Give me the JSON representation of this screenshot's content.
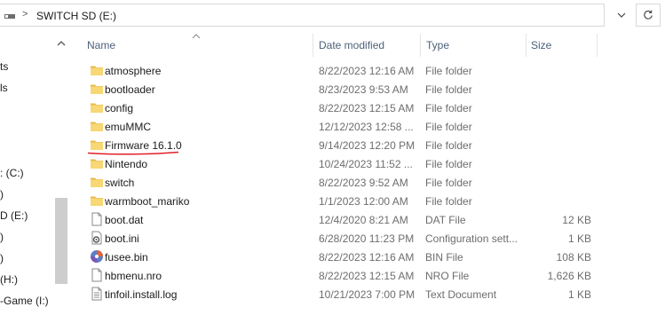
{
  "address_bar": {
    "separator": ">",
    "path": "SWITCH SD (E:)",
    "dropdown_icon": "chevron-down-icon",
    "refresh_icon": "refresh-icon"
  },
  "nav_pane": {
    "items": [
      {
        "label": "ts"
      },
      {
        "label": "ls"
      },
      {
        "label": ": (C:)"
      },
      {
        "label": ")"
      },
      {
        "label": "D (E:)"
      },
      {
        "label": ")"
      },
      {
        "label": ")"
      },
      {
        "label": "(H:)"
      },
      {
        "label": "-Game (I:)"
      }
    ]
  },
  "columns": {
    "name": "Name",
    "date_modified": "Date modified",
    "type": "Type",
    "size": "Size"
  },
  "files": [
    {
      "name": "atmosphere",
      "date": "8/22/2023 12:16 AM",
      "type": "File folder",
      "size": "",
      "icon": "folder-icon"
    },
    {
      "name": "bootloader",
      "date": "8/23/2023 9:53 AM",
      "type": "File folder",
      "size": "",
      "icon": "folder-icon"
    },
    {
      "name": "config",
      "date": "8/22/2023 12:15 AM",
      "type": "File folder",
      "size": "",
      "icon": "folder-icon"
    },
    {
      "name": "emuMMC",
      "date": "12/12/2023 12:58 ...",
      "type": "File folder",
      "size": "",
      "icon": "folder-icon"
    },
    {
      "name": "Firmware 16.1.0",
      "date": "9/14/2023 12:20 PM",
      "type": "File folder",
      "size": "",
      "icon": "folder-icon"
    },
    {
      "name": "Nintendo",
      "date": "10/24/2023 11:52 ...",
      "type": "File folder",
      "size": "",
      "icon": "folder-icon"
    },
    {
      "name": "switch",
      "date": "8/22/2023 9:52 AM",
      "type": "File folder",
      "size": "",
      "icon": "folder-icon"
    },
    {
      "name": "warmboot_mariko",
      "date": "1/1/2023 12:00 AM",
      "type": "File folder",
      "size": "",
      "icon": "folder-icon"
    },
    {
      "name": "boot.dat",
      "date": "12/4/2020 8:21 AM",
      "type": "DAT File",
      "size": "12 KB",
      "icon": "file-icon"
    },
    {
      "name": "boot.ini",
      "date": "6/28/2020 11:23 PM",
      "type": "Configuration sett...",
      "size": "1 KB",
      "icon": "config-file-icon"
    },
    {
      "name": "fusee.bin",
      "date": "8/22/2023 12:16 AM",
      "type": "BIN File",
      "size": "108 KB",
      "icon": "disc-image-icon"
    },
    {
      "name": "hbmenu.nro",
      "date": "8/22/2023 12:15 AM",
      "type": "NRO File",
      "size": "1,626 KB",
      "icon": "file-icon"
    },
    {
      "name": "tinfoil.install.log",
      "date": "10/21/2023 7:00 PM",
      "type": "Text Document",
      "size": "1 KB",
      "icon": "text-file-icon"
    }
  ],
  "colors": {
    "folder": "#f8d775",
    "header_text": "#4c607a",
    "secondary_text": "#6d6d6d",
    "annotation": "#e0202a"
  }
}
